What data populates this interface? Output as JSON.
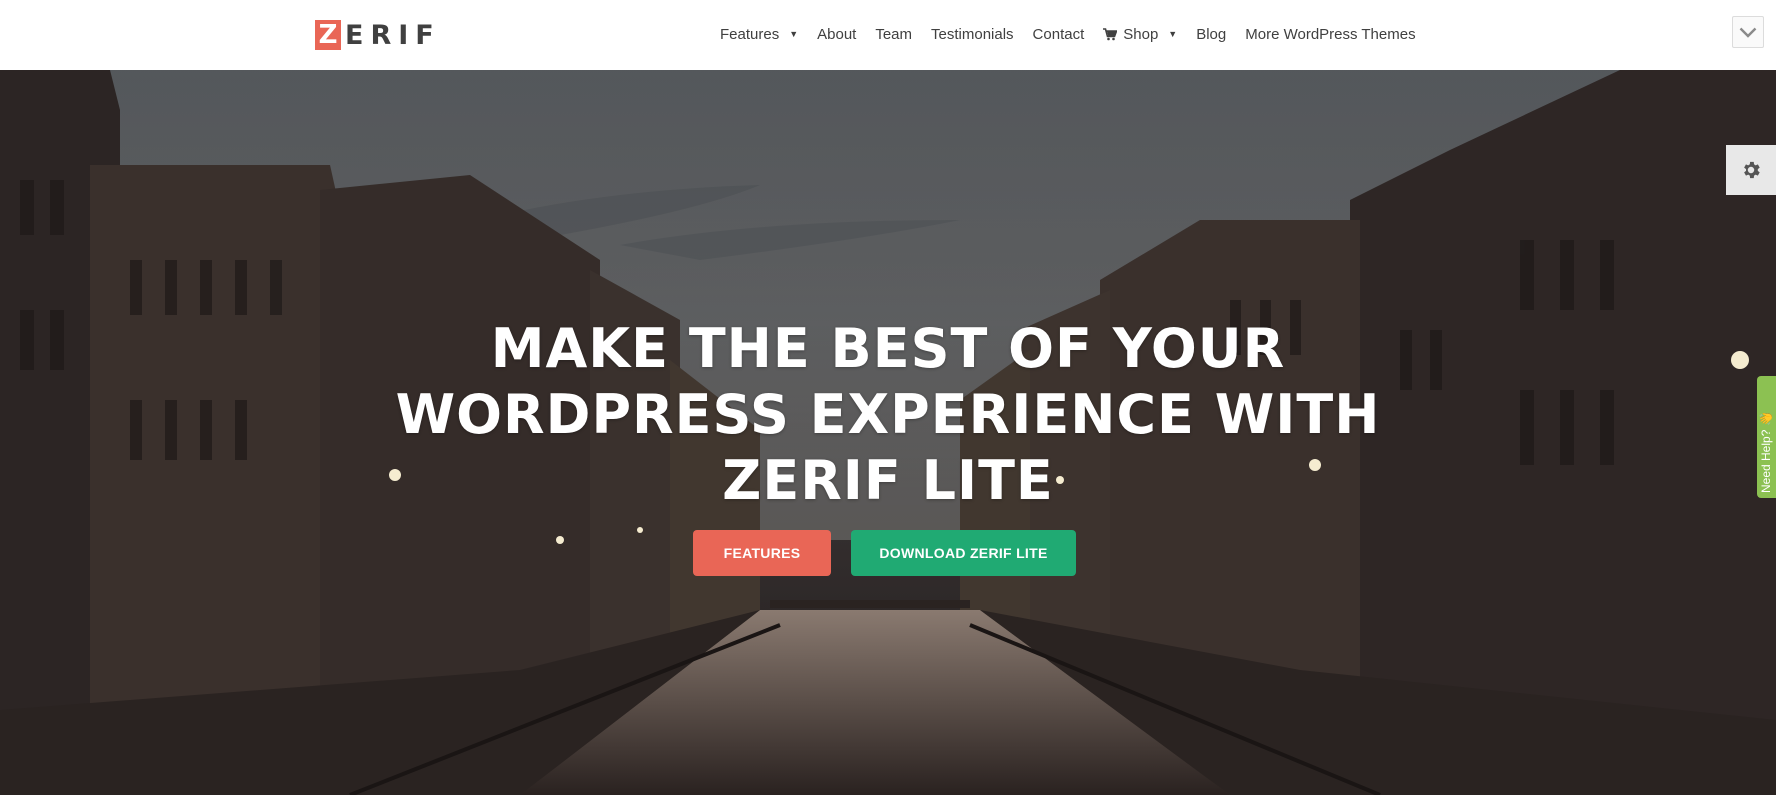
{
  "logo": {
    "mark": "Z",
    "rest": "ERIF"
  },
  "nav": {
    "items": [
      {
        "label": "Features",
        "dropdown": true
      },
      {
        "label": "About"
      },
      {
        "label": "Team"
      },
      {
        "label": "Testimonials"
      },
      {
        "label": "Contact"
      },
      {
        "label": "Shop",
        "dropdown": true,
        "icon": "cart-icon"
      },
      {
        "label": "Blog"
      },
      {
        "label": "More WordPress Themes"
      }
    ]
  },
  "hero": {
    "title": "MAKE THE BEST OF YOUR WORDPRESS EXPERIENCE WITH ZERIF LITE",
    "buttons": {
      "features": "FEATURES",
      "download": "DOWNLOAD ZERIF LITE"
    }
  },
  "help_tab": {
    "label": "Need Help? 👋"
  },
  "colors": {
    "accent_red": "#e96656",
    "accent_green": "#20aa73",
    "help_green": "#8cc152",
    "text_dark": "#404040"
  },
  "icons": {
    "collapse": "chevron-down-icon",
    "settings": "gear-icon",
    "cart": "cart-icon"
  }
}
